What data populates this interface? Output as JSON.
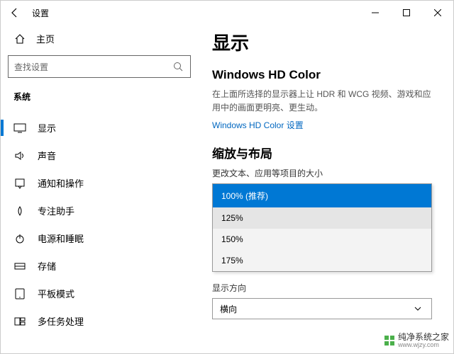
{
  "window": {
    "title": "设置",
    "controls": {
      "minimize": "–",
      "maximize": "▢",
      "close": "✕"
    }
  },
  "sidebar": {
    "home_label": "主页",
    "search_placeholder": "查找设置",
    "group_label": "系统",
    "items": [
      {
        "label": "显示",
        "icon": "display-icon",
        "active": true
      },
      {
        "label": "声音",
        "icon": "sound-icon"
      },
      {
        "label": "通知和操作",
        "icon": "notification-icon"
      },
      {
        "label": "专注助手",
        "icon": "focus-icon"
      },
      {
        "label": "电源和睡眠",
        "icon": "power-icon"
      },
      {
        "label": "存储",
        "icon": "storage-icon"
      },
      {
        "label": "平板模式",
        "icon": "tablet-icon"
      },
      {
        "label": "多任务处理",
        "icon": "multitask-icon"
      }
    ]
  },
  "content": {
    "page_title": "显示",
    "hd_color": {
      "heading": "Windows HD Color",
      "desc": "在上面所选择的显示器上让 HDR 和 WCG 视频、游戏和应用中的画面更明亮、更生动。",
      "link": "Windows HD Color 设置"
    },
    "scale_layout": {
      "heading": "缩放与布局",
      "scale_label": "更改文本、应用等项目的大小",
      "scale_options": [
        "100% (推荐)",
        "125%",
        "150%",
        "175%"
      ],
      "scale_selected": "100% (推荐)",
      "orientation_label": "显示方向",
      "orientation_value": "横向"
    }
  },
  "watermark": {
    "text": "纯净系统之家",
    "url": "www.wjzy.com"
  }
}
